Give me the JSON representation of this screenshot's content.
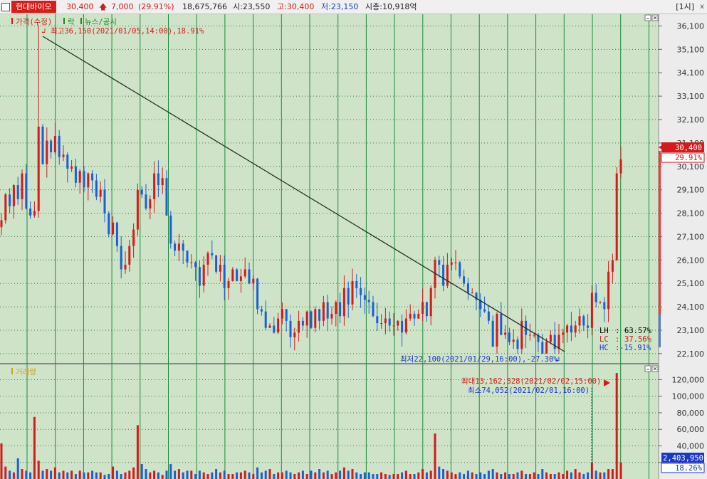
{
  "header": {
    "stock_name": "현대바이오",
    "price": "30,400",
    "change": "7,000",
    "change_pct": "(29.91%)",
    "volume": "18,675,766",
    "open": "시:23,550",
    "high": "고:30,400",
    "low": "저:23,150",
    "market_cap": "시총:10,918억",
    "period": "[1시]",
    "close": "x"
  },
  "price_panel": {
    "legend": [
      "가격(수정)",
      "락",
      "뉴스/공시"
    ],
    "high_label": "최고36,150(2021/01/05,14:00),18.91%",
    "low_label": "최저22,100(2021/01/29,16:00),-27.30%",
    "y_ticks": [
      "36,100",
      "35,100",
      "34,100",
      "33,100",
      "32,100",
      "31,100",
      "30,100",
      "29,100",
      "28,100",
      "27,100",
      "26,100",
      "25,100",
      "24,100",
      "23,100",
      "22,100"
    ],
    "current_price_badge": "30,400",
    "current_pct_badge": "29.91%",
    "stats": [
      {
        "key": "LH",
        "sep": ":",
        "value": "63.57%",
        "color": "#000000"
      },
      {
        "key": "LC",
        "sep": ":",
        "value": "37.56%",
        "color": "#d41a1a"
      },
      {
        "key": "HC",
        "sep": ":",
        "value": "-15.91%",
        "color": "#1a39c8"
      }
    ]
  },
  "volume_panel": {
    "legend": "거래량",
    "max_label": "최대13,162,528(2021/02/02,15:00)",
    "min_label": "최소74,052(2021/02/01,16:00)",
    "y_ticks": [
      "120,000",
      "100,000",
      "80,000",
      "60,000",
      "40,000",
      "20,000"
    ],
    "current_volume_badge": "2,403,950",
    "current_pct_badge": "18.26%"
  },
  "colors": {
    "background": "#cfe3c9",
    "up": "#d41a1a",
    "down": "#1a5fd4",
    "grid_vertical": "#1f8a3a",
    "grid_horizontal": "#3a7a3a",
    "trendline": "#1a2a1a",
    "stock_name_bg": "#d81c1c"
  },
  "chart_data": {
    "type": "candlestick",
    "interval": "1시",
    "y_range": [
      21700,
      36600
    ],
    "high": 36150,
    "low": 22100,
    "last_close": 30400,
    "closes": [
      27800,
      28900,
      28400,
      29300,
      28700,
      29800,
      28300,
      28000,
      28200,
      31800,
      30200,
      31200,
      30700,
      31400,
      30500,
      30600,
      30000,
      30100,
      29400,
      29900,
      29200,
      29800,
      29500,
      28800,
      29100,
      28100,
      27200,
      27700,
      26700,
      25700,
      25900,
      26700,
      27400,
      29100,
      28900,
      28300,
      28700,
      29800,
      29300,
      29600,
      28000,
      26800,
      26500,
      26800,
      26500,
      26000,
      26000,
      25800,
      25000,
      25900,
      26400,
      26300,
      25600,
      25900,
      24900,
      25200,
      25700,
      25200,
      25400,
      25700,
      25100,
      25300,
      24000,
      23900,
      23200,
      23300,
      23000,
      23600,
      24000,
      23500,
      22800,
      23000,
      23500,
      23300,
      23900,
      23200,
      24000,
      23500,
      24300,
      23600,
      23800,
      24300,
      23700,
      24900,
      24200,
      25200,
      24900,
      24600,
      24400,
      24300,
      23700,
      23400,
      23400,
      23600,
      23300,
      23300,
      23500,
      23000,
      23600,
      23800,
      23600,
      23800,
      24300,
      23700,
      24900,
      26100,
      25900,
      25000,
      25900,
      26000,
      26000,
      25400,
      25100,
      24700,
      24700,
      24400,
      24000,
      23900,
      23500,
      22400,
      23800,
      22900,
      23000,
      22600,
      22700,
      22300,
      23500,
      22900,
      22900,
      22900,
      22600,
      22100,
      22600,
      22900,
      22300,
      22900,
      23000,
      23300,
      23000,
      23300,
      23700,
      23300,
      23200,
      24700,
      24300,
      24300,
      24000,
      25600,
      26100,
      29800,
      30400
    ],
    "volumes": [
      43,
      15,
      10,
      8,
      25,
      12,
      10,
      8,
      75,
      22,
      10,
      12,
      10,
      14,
      8,
      10,
      8,
      10,
      6,
      10,
      8,
      8,
      10,
      8,
      8,
      5,
      6,
      15,
      10,
      6,
      8,
      10,
      14,
      65,
      18,
      12,
      8,
      10,
      8,
      5,
      10,
      18,
      10,
      12,
      8,
      10,
      10,
      6,
      10,
      8,
      6,
      8,
      12,
      8,
      10,
      6,
      6,
      8,
      8,
      10,
      8,
      6,
      14,
      8,
      10,
      12,
      6,
      8,
      8,
      10,
      8,
      6,
      8,
      10,
      6,
      10,
      8,
      12,
      8,
      10,
      6,
      8,
      10,
      14,
      10,
      12,
      8,
      6,
      8,
      8,
      6,
      6,
      8,
      6,
      5,
      6,
      6,
      8,
      10,
      6,
      6,
      8,
      12,
      8,
      10,
      55,
      15,
      12,
      10,
      8,
      6,
      8,
      6,
      10,
      8,
      6,
      8,
      6,
      10,
      12,
      8,
      6,
      8,
      6,
      6,
      8,
      10,
      6,
      6,
      8,
      6,
      12,
      8,
      6,
      6,
      8,
      6,
      10,
      8,
      12,
      8,
      6,
      8,
      20,
      10,
      8,
      8,
      12,
      12,
      128,
      20
    ]
  }
}
